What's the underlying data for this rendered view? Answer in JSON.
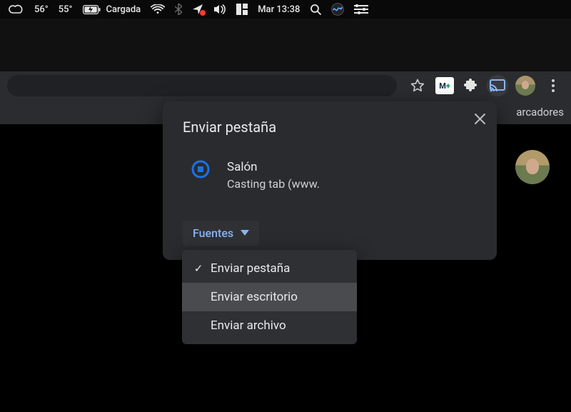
{
  "menubar": {
    "temp1": "56°",
    "temp2": "55°",
    "battery_label": "Cargada",
    "clock": "Mar 13:38"
  },
  "toolbar": {
    "moverplus_m": "M",
    "moverplus_plus": "+"
  },
  "bookmarkbar": {
    "partial_label": "arcadores"
  },
  "cast_popup": {
    "title": "Enviar pestaña",
    "device": {
      "name": "Salón",
      "status": "Casting tab (www."
    },
    "sources_label": "Fuentes"
  },
  "sources_menu": {
    "items": [
      {
        "label": "Enviar pestaña",
        "checked": true,
        "hover": false
      },
      {
        "label": "Enviar escritorio",
        "checked": false,
        "hover": true
      },
      {
        "label": "Enviar archivo",
        "checked": false,
        "hover": false
      }
    ]
  }
}
